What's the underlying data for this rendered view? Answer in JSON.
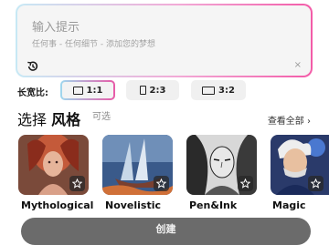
{
  "prompt": {
    "title": "输入提示",
    "subtitle": "任何事 - 任何细节 - 添加您的梦想",
    "clear": "×"
  },
  "ratio": {
    "label": "长宽比:",
    "options": [
      {
        "label": "1:1",
        "selected": true
      },
      {
        "label": "2:3",
        "selected": false
      },
      {
        "label": "3:2",
        "selected": false
      }
    ]
  },
  "styles": {
    "title_prefix": "选择",
    "title_bold": "风格",
    "optional": "可选",
    "view_all": "查看全部 ›",
    "cards": [
      {
        "label": "Mythological",
        "icon": "star-icon"
      },
      {
        "label": "Novelistic",
        "icon": "star-icon"
      },
      {
        "label": "Pen&Ink",
        "icon": "star-icon"
      },
      {
        "label": "Magic",
        "icon": "star-icon"
      }
    ]
  },
  "create_button": "创建"
}
